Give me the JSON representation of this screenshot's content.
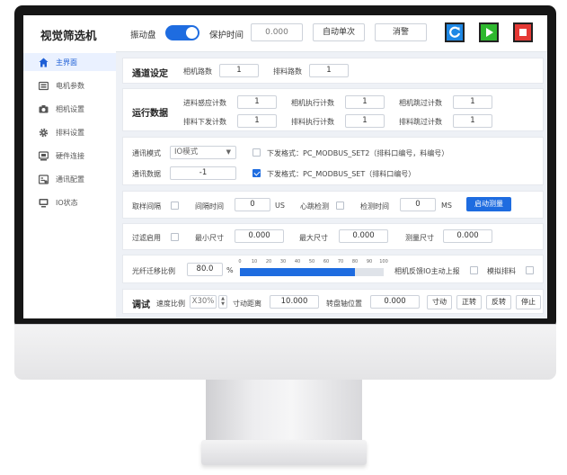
{
  "app": {
    "title": "视觉筛选机"
  },
  "sidebar": {
    "items": [
      {
        "label": "主界面",
        "icon": "home-icon",
        "active": true
      },
      {
        "label": "电机参数",
        "icon": "motor-icon"
      },
      {
        "label": "相机设置",
        "icon": "camera-icon"
      },
      {
        "label": "排料设置",
        "icon": "gear-icon"
      },
      {
        "label": "硬件连接",
        "icon": "hardware-icon"
      },
      {
        "label": "通讯配置",
        "icon": "comm-icon"
      },
      {
        "label": "IO状态",
        "icon": "io-icon"
      }
    ]
  },
  "topbar": {
    "vibration_label": "振动盘",
    "vibration_on": true,
    "protect_label": "保护时间",
    "protect_value": "0.000",
    "auto_single_label": "自动单次",
    "clear_alarm_label": "消警",
    "refresh_color": "#1e88e5",
    "start_color": "#2eb82e",
    "stop_color": "#e53935"
  },
  "channel": {
    "title": "通道设定",
    "camera_count_label": "相机路数",
    "camera_count": "1",
    "discharge_count_label": "排料路数",
    "discharge_count": "1"
  },
  "runtime": {
    "title": "运行数据",
    "feed_sense_label": "进料感应计数",
    "feed_sense": "1",
    "cam_exec_label": "相机执行计数",
    "cam_exec": "1",
    "cam_skip_label": "相机跳过计数",
    "cam_skip": "1",
    "dis_send_label": "排料下发计数",
    "dis_send": "1",
    "dis_exec_label": "排料执行计数",
    "dis_exec": "1",
    "dis_skip_label": "排料跳过计数",
    "dis_skip": "1"
  },
  "comm": {
    "mode_label": "通讯模式",
    "mode_value": "IO模式",
    "format2_checked": false,
    "format2_label": "下发格式：PC_MODBUS_SET2（排料口编号，料编号）",
    "data_label": "通讯数据",
    "data_value": "-1",
    "format1_checked": true,
    "format1_label": "下发格式：PC_MODBUS_SET（排料口编号）"
  },
  "sampling": {
    "interval_label": "取样间隔",
    "interval_time_label": "间隔时间",
    "interval_time": "0",
    "interval_unit": "US",
    "heartbeat_label": "心跳检测",
    "detect_time_label": "检测时间",
    "detect_time": "0",
    "detect_unit": "MS",
    "start_measure_label": "启动测量"
  },
  "filter": {
    "enable_label": "过滤启用",
    "min_label": "最小尺寸",
    "min_value": "0.000",
    "max_label": "最大尺寸",
    "max_value": "0.000",
    "measure_label": "测量尺寸",
    "measure_value": "0.000"
  },
  "fiber": {
    "ratio_label": "光纤迁移比例",
    "ratio_value": "80.0",
    "unit": "%",
    "ticks": [
      "0",
      "10",
      "20",
      "30",
      "40",
      "50",
      "60",
      "70",
      "80",
      "90",
      "100"
    ],
    "progress": 0.8,
    "cam_feedback_label": "相机反馈IO主动上报",
    "simulate_label": "模拟排料"
  },
  "debug": {
    "title": "调试",
    "speed_label": "速度比例",
    "speed_value": "X30%",
    "jog_label": "寸动距离",
    "jog_value": "10.000",
    "turntable_label": "转盘轴位置",
    "turntable_value": "0.000",
    "jog_btn": "寸动",
    "forward_btn": "正转",
    "reverse_btn": "反转",
    "stop_btn": "停止"
  }
}
